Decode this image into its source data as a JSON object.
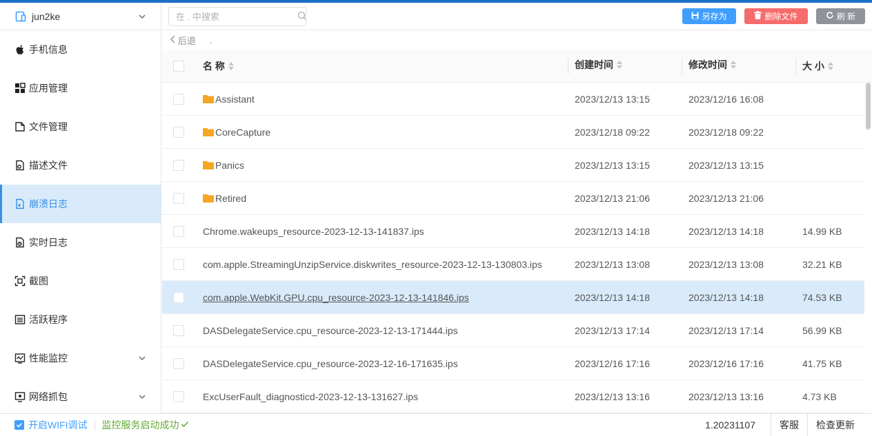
{
  "device": {
    "name": "jun2ke"
  },
  "sidebar": {
    "items": [
      {
        "label": "手机信息",
        "icon": "apple-icon"
      },
      {
        "label": "应用管理",
        "icon": "apps-grid-icon"
      },
      {
        "label": "文件管理",
        "icon": "folder-manage-icon"
      },
      {
        "label": "描述文件",
        "icon": "profile-file-icon"
      },
      {
        "label": "崩溃日志",
        "icon": "crash-log-icon"
      },
      {
        "label": "实时日志",
        "icon": "realtime-log-icon"
      },
      {
        "label": "截图",
        "icon": "screenshot-icon"
      },
      {
        "label": "活跃程序",
        "icon": "active-apps-icon"
      },
      {
        "label": "性能监控",
        "icon": "performance-icon"
      },
      {
        "label": "网络抓包",
        "icon": "network-capture-icon"
      }
    ],
    "active_index": 4
  },
  "toolbar": {
    "search_placeholder": "在 . 中搜索",
    "save_label": "另存为",
    "delete_label": "删除文件",
    "refresh_label": "刷 新"
  },
  "breadcrumb": {
    "back_label": "后退",
    "path": "."
  },
  "table": {
    "headers": {
      "name": "名 称",
      "created": "创建时间",
      "modified": "修改时间",
      "size": "大 小"
    },
    "rows": [
      {
        "type": "folder",
        "name": "Assistant",
        "created": "2023/12/13 13:15",
        "modified": "2023/12/16 16:08",
        "size": ""
      },
      {
        "type": "folder",
        "name": "CoreCapture",
        "created": "2023/12/18 09:22",
        "modified": "2023/12/18 09:22",
        "size": ""
      },
      {
        "type": "folder",
        "name": "Panics",
        "created": "2023/12/13 13:15",
        "modified": "2023/12/13 13:15",
        "size": ""
      },
      {
        "type": "folder",
        "name": "Retired",
        "created": "2023/12/13 21:06",
        "modified": "2023/12/13 21:06",
        "size": ""
      },
      {
        "type": "file",
        "name": "Chrome.wakeups_resource-2023-12-13-141837.ips",
        "created": "2023/12/13 14:18",
        "modified": "2023/12/13 14:18",
        "size": "14.99 KB"
      },
      {
        "type": "file",
        "name": "com.apple.StreamingUnzipService.diskwrites_resource-2023-12-13-130803.ips",
        "created": "2023/12/13 13:08",
        "modified": "2023/12/13 13:08",
        "size": "32.21 KB"
      },
      {
        "type": "file",
        "name": "com.apple.WebKit.GPU.cpu_resource-2023-12-13-141846.ips",
        "created": "2023/12/13 14:18",
        "modified": "2023/12/13 14:18",
        "size": "74.53 KB",
        "selected": true
      },
      {
        "type": "file",
        "name": "DASDelegateService.cpu_resource-2023-12-13-171444.ips",
        "created": "2023/12/13 17:14",
        "modified": "2023/12/13 17:14",
        "size": "56.99 KB"
      },
      {
        "type": "file",
        "name": "DASDelegateService.cpu_resource-2023-12-16-171635.ips",
        "created": "2023/12/16 17:16",
        "modified": "2023/12/16 17:16",
        "size": "41.75 KB"
      },
      {
        "type": "file",
        "name": "ExcUserFault_diagnosticd-2023-12-13-131627.ips",
        "created": "2023/12/13 13:16",
        "modified": "2023/12/13 13:16",
        "size": "4.73 KB"
      }
    ]
  },
  "footer": {
    "wifi_label": "开启WIFI调试",
    "status_label": "监控服务启动成功",
    "version": "1.20231107",
    "support_label": "客服",
    "update_label": "检查更新"
  },
  "colors": {
    "accent": "#409eff",
    "danger": "#f56c6c",
    "neutral": "#909399",
    "selected_row": "#d9ebfb",
    "success": "#67a83a",
    "folder": "#f5a623"
  }
}
